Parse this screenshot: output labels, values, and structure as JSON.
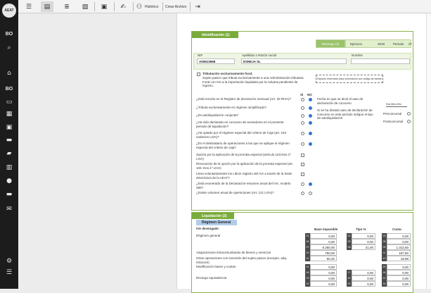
{
  "app": {
    "logo_text": "AEAT"
  },
  "sidebar": {
    "items": [
      {
        "name": "bo-icon-top",
        "text": "BO"
      },
      {
        "name": "search-icon",
        "text": "⌕"
      },
      {
        "name": "home-icon",
        "text": "⌂"
      },
      {
        "name": "bo-icon",
        "text": "BO"
      },
      {
        "name": "inbox-icon",
        "text": "▭"
      },
      {
        "name": "calendar-icon",
        "text": "▦"
      },
      {
        "name": "monitor-icon",
        "text": "▣"
      },
      {
        "name": "car-icon",
        "text": "▬"
      },
      {
        "name": "truck-icon",
        "text": "▰"
      },
      {
        "name": "building-icon",
        "text": "▥"
      },
      {
        "name": "person-icon",
        "text": "●"
      },
      {
        "name": "folder-icon",
        "text": "▬"
      },
      {
        "name": "mail-icon",
        "text": "✉"
      },
      {
        "name": "settings-icon",
        "text": "⚙"
      },
      {
        "name": "list-settings-icon",
        "text": "☰"
      }
    ]
  },
  "toolbar": {
    "historico": "Histórico",
    "crear_archivo": "Crear Archivo"
  },
  "identificacion": {
    "title": "Identificación (1)",
    "tabs": {
      "devengo": "Devengo (2)",
      "ejercicio_label": "Ejercicio",
      "ejercicio": "2019",
      "periodo_label": "Periodo",
      "periodo": "4T"
    },
    "nif_label": "NIF",
    "nif": "A00613968",
    "razon_label": "Apellidos o Razón social",
    "razon": "ESNEJA SL",
    "nombre_label": "Nombre",
    "nombre": "",
    "tributacion_title": "Tributación exclusivamente foral.",
    "tributacion_text": "Sujeto pasivo que tributa exclusivamente a una Administración tributaria Foral con IVA a la importación liquidado por la Aduana pendiente de ingreso.",
    "reservado": "Espacio reservado para numeración por código de barras",
    "si": "SI",
    "no": "NO",
    "questions": [
      {
        "text": "¿Está inscrito en el Registro de devolución mensual (Art. 30 RIVA)?",
        "ctrl": "radio",
        "si": false,
        "no": true
      },
      {
        "text": "¿Tributa exclusivamente en régimen simplificado?",
        "ctrl": "radio",
        "si": false,
        "no": true
      },
      {
        "text": "¿Es autoliquidación conjunta?",
        "ctrl": "radio",
        "si": false,
        "no": true
      },
      {
        "text": "¿Ha sido declarado en concurso de acreedores en el presente periodo de liquidación?",
        "ctrl": "radio",
        "si": false,
        "no": true
      },
      {
        "text": "¿Ha optado por el régimen especial del criterio de Caja (art. 163 undecies LIVA)?",
        "ctrl": "radio",
        "si": false,
        "no": true
      },
      {
        "text": "¿Es el destinatario de operaciones a las que se aplique el régimen especial del criterio de caja?",
        "ctrl": "radio",
        "si": false,
        "no": true
      },
      {
        "text": "Opción por la aplicación de la prorrata especial (artículo 103.Dos.1º LIVA)",
        "ctrl": "check"
      },
      {
        "text": "Revocación de la opción por la aplicación de la prorrata especial (art. 103. Dos.1º LIVA)",
        "ctrl": "check"
      },
      {
        "text": "Lleva voluntariamente los Libros registro del IVA a través de la Sede electrónica de la AEAT?",
        "ctrl": "check"
      },
      {
        "text": "¿Está exonerado de la Declaración-resumen anual del IVA, modelo 390?",
        "ctrl": "radio",
        "si": false,
        "no": true
      },
      {
        "text": "¿Existe volumen anual de operaciones (Art. 121 LIVA)?",
        "ctrl": "radio",
        "si": false,
        "no": false
      }
    ],
    "concurso_fecha": "Fecha en que se dictó el auto de declaración de concurso",
    "concurso_tipo": "Si se ha dictado auto de declaración de concurso en este periodo indique el tipo de autoliquidación",
    "dia_mes_ano": "Día Mes Año",
    "preconcursal": "Preconcursal",
    "postconcursal": "Postconcursal"
  },
  "liquidacion": {
    "title": "Liquidación (3)",
    "regimen": "Régimen General",
    "iva_devengado": "IVA devengado",
    "headers": {
      "base": "Base imponible",
      "tipo": "Tipo %",
      "cuota": "Cuota"
    },
    "rows": [
      {
        "label": "Régimen general",
        "codes": [
          "01",
          "02",
          "03"
        ],
        "vals": [
          "0,00",
          "0,00",
          "0,00"
        ]
      },
      {
        "label": "",
        "codes": [
          "04",
          "05",
          "06"
        ],
        "vals": [
          "0,00",
          "0,00",
          "0,00"
        ]
      },
      {
        "label": "",
        "codes": [
          "07",
          "08",
          "09"
        ],
        "vals": [
          "6.250,00",
          "21,00",
          "1.312,50"
        ]
      },
      {
        "label": "Adquisiciones intracomunitarias de bienes y servicios",
        "codes": [
          "10",
          "",
          "11"
        ],
        "vals": [
          "750,00",
          "",
          "157,50"
        ]
      },
      {
        "label": "Otras operaciones con inversión del sujeto pasivo (excepto. adq. intracom)",
        "codes": [
          "12",
          "",
          "13"
        ],
        "vals": [
          "90,40",
          "",
          "18,98"
        ]
      },
      {
        "label": "Modificación bases y cuotas",
        "codes": [
          "14",
          "",
          "15"
        ],
        "vals": [
          "0,00",
          "",
          "0,00"
        ]
      },
      {
        "label": "",
        "codes": [
          "16",
          "17",
          "18"
        ],
        "vals": [
          "0,00",
          "0,00",
          "0,00"
        ]
      },
      {
        "label": "Recargo equivalencia",
        "codes": [
          "19",
          "20",
          "21"
        ],
        "vals": [
          "0,00",
          "0,00",
          "0,00"
        ]
      },
      {
        "label": "",
        "codes": [
          "22",
          "23",
          "24"
        ],
        "vals": [
          "0,00",
          "0,00",
          "0,00"
        ]
      }
    ]
  }
}
